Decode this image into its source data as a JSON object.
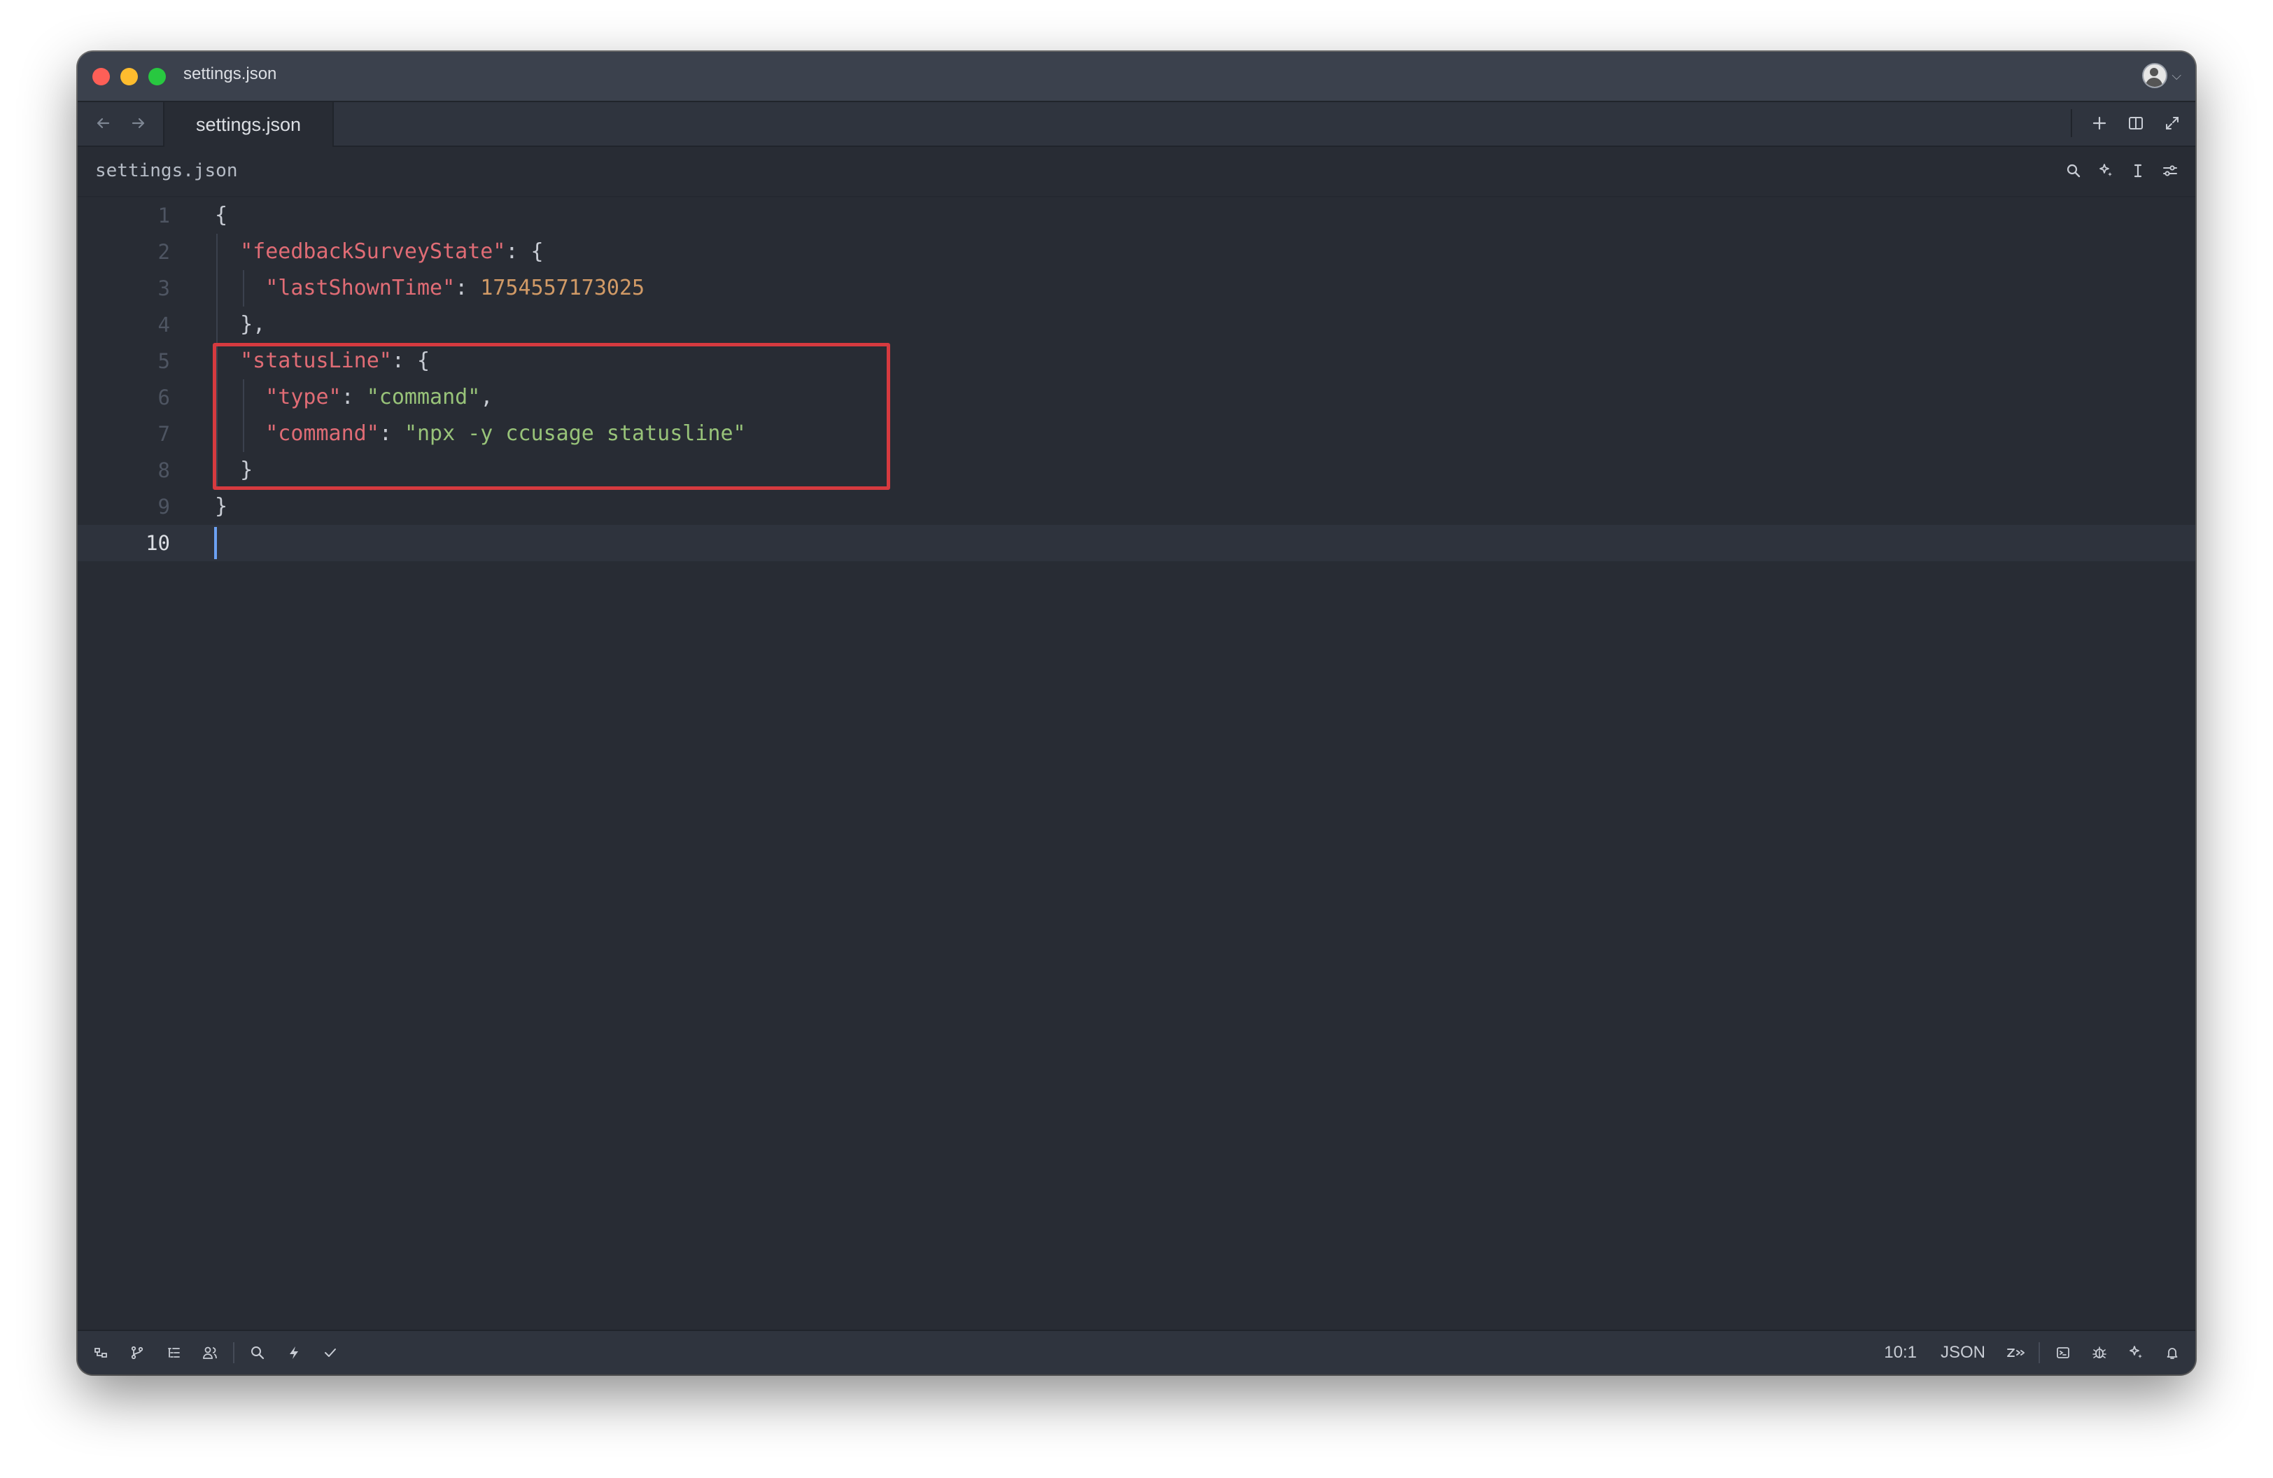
{
  "window": {
    "title": "settings.json"
  },
  "tabs": [
    {
      "label": "settings.json",
      "active": true
    }
  ],
  "breadcrumb": "settings.json",
  "editor": {
    "language": "JSON",
    "lines": [
      {
        "number": "1",
        "text": "{"
      },
      {
        "number": "2",
        "text": "\"feedbackSurveyState\": {"
      },
      {
        "number": "3",
        "text": "\"lastShownTime\": 1754557173025"
      },
      {
        "number": "4",
        "text": "},"
      },
      {
        "number": "5",
        "text": "\"statusLine\": {"
      },
      {
        "number": "6",
        "text": "\"type\": \"command\","
      },
      {
        "number": "7",
        "text": "\"command\": \"npx -y ccusage statusline\""
      },
      {
        "number": "8",
        "text": "}"
      },
      {
        "number": "9",
        "text": "}"
      },
      {
        "number": "10",
        "text": ""
      }
    ],
    "tokens": {
      "l1_brace": "{",
      "l2_key": "\"feedbackSurveyState\"",
      "l2_rest": ": {",
      "l3_key": "\"lastShownTime\"",
      "l3_colon": ": ",
      "l3_value": "1754557173025",
      "l4": "},",
      "l5_key": "\"statusLine\"",
      "l5_rest": ": {",
      "l6_key": "\"type\"",
      "l6_colon": ": ",
      "l6_value": "\"command\"",
      "l6_comma": ",",
      "l7_key": "\"command\"",
      "l7_colon": ": ",
      "l7_value": "\"npx -y ccusage statusline\"",
      "l8": "}",
      "l9": "}"
    }
  },
  "statusbar": {
    "cursor_position": "10:1",
    "language": "JSON"
  },
  "colors": {
    "key": "#e06c75",
    "string": "#98c379",
    "number": "#d19a66",
    "highlight_box": "#d63a3f",
    "cursor": "#6ca1f2"
  },
  "icons": {
    "titlebar": [
      "user-avatar-icon",
      "chevron-down-icon"
    ],
    "tabbar": [
      "back-arrow-icon",
      "forward-arrow-icon",
      "plus-icon",
      "split-pane-icon",
      "maximize-icon"
    ],
    "breadcrumb": [
      "search-icon",
      "sparkle-icon",
      "text-cursor-icon",
      "sliders-icon"
    ],
    "statusbar_left": [
      "project-panel-icon",
      "git-branch-icon",
      "outline-icon",
      "collab-icon",
      "search-icon",
      "bolt-icon",
      "check-icon"
    ],
    "statusbar_right": [
      "agent-icon",
      "terminal-icon",
      "debug-icon",
      "sparkle-icon",
      "bell-icon"
    ]
  }
}
